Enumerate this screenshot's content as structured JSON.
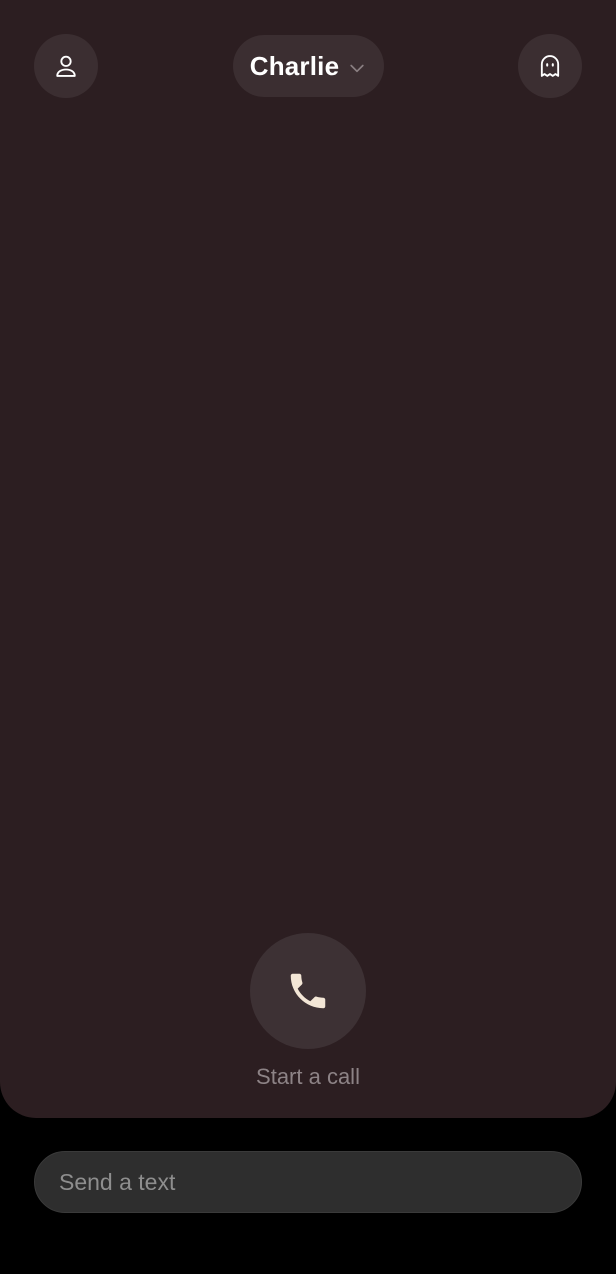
{
  "header": {
    "persona_name": "Charlie",
    "profile_icon": "person-icon",
    "persona_chevron_icon": "chevron-down-icon",
    "ghost_icon": "ghost-icon"
  },
  "call": {
    "icon": "phone-icon",
    "label": "Start a call"
  },
  "composer": {
    "placeholder": "Send a text",
    "value": ""
  },
  "colors": {
    "background": "#000000",
    "panel": "#2c1e21",
    "button": "#3b2e31",
    "phone_icon": "#f3e6d6",
    "muted_text": "#8d8386"
  }
}
